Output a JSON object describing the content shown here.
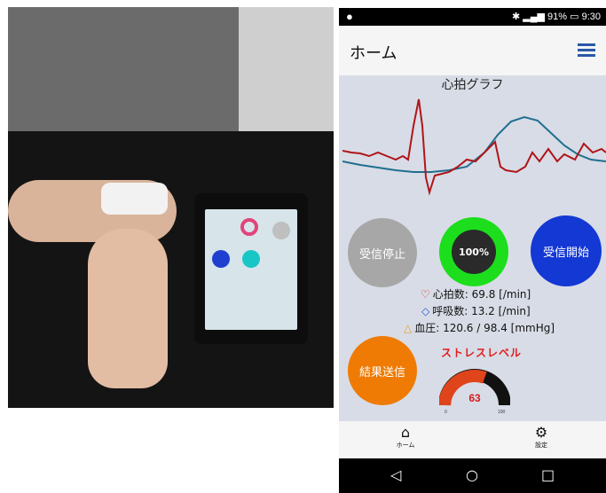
{
  "phone": {
    "status": {
      "time": "9:30",
      "battery": "91%"
    },
    "appbar": {
      "title": "ホーム",
      "menu_icon": "menu-icon"
    },
    "graph_title": "心拍グラフ",
    "buttons": {
      "stop_label": "受信停止",
      "start_label": "受信開始",
      "send_label": "結果送信"
    },
    "progress": {
      "label": "100%",
      "value": 100
    },
    "vitals": {
      "heart_rate": "心拍数: 69.8 [/min]",
      "respiration": "呼吸数: 13.2 [/min]",
      "blood_pressure": "血圧: 120.6 / 98.4 [mmHg]"
    },
    "stress": {
      "label": "ストレスレベル",
      "value": "63",
      "min": "0",
      "max": "100"
    },
    "nav": {
      "home_label": "ホーム",
      "settings_label": "設定"
    },
    "colors": {
      "stop": "#a7a7a7",
      "start": "#1438d4",
      "send": "#ef7b05",
      "ring": "#1cde1c",
      "stress_label": "#e21b1b",
      "ecg": "#b0151a",
      "resp": "#1f6f8f"
    }
  }
}
